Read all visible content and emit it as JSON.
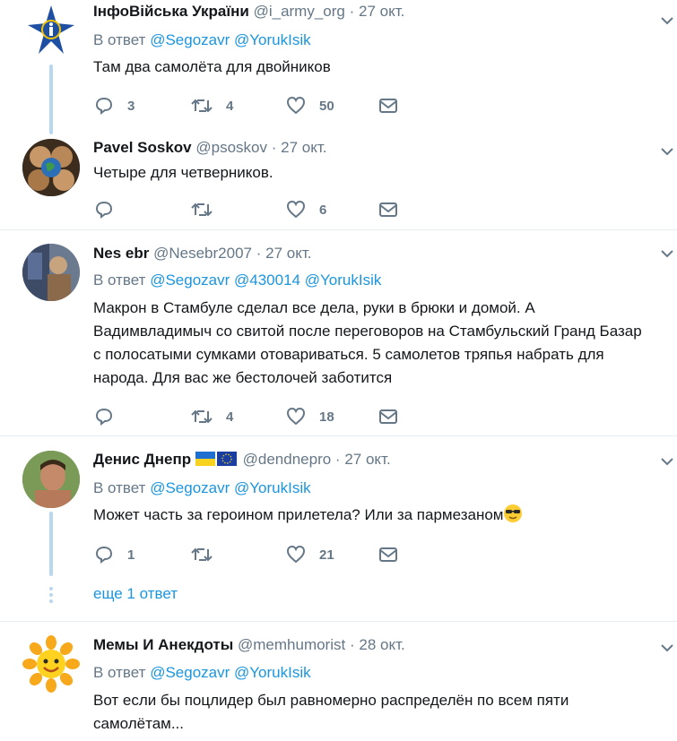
{
  "tweets": [
    {
      "name": "ІнфоВійська України",
      "handle": "@i_army_org",
      "sep": "·",
      "time": "27 окт.",
      "reply_prefix": "В ответ",
      "mentions": [
        "@Segozavr",
        "@YorukIsik"
      ],
      "text_lines": [
        "Там два самолёта для двойников"
      ],
      "reply_count": "3",
      "retweet_count": "4",
      "like_count": "50"
    },
    {
      "name": "Pavel Soskov",
      "handle": "@psoskov",
      "sep": "·",
      "time": "27 окт.",
      "text_lines": [
        "Четыре для четверников."
      ],
      "reply_count": "",
      "retweet_count": "",
      "like_count": "6"
    },
    {
      "name": "Nes ebr",
      "handle": "@Nesebr2007",
      "sep": "·",
      "time": "27 окт.",
      "reply_prefix": "В ответ",
      "mentions": [
        "@Segozavr",
        "@430014",
        "@YorukIsik"
      ],
      "text_lines": [
        "Макрон в Стамбуле сделал все дела, руки в брюки и домой. А",
        "Вадимвладимыч со свитой после переговоров на Стамбульский Гранд Базар",
        "с полосатыми сумками отовариваться. 5 самолетов тряпья набрать для",
        "народа. Для вас же бестолочей заботится"
      ],
      "reply_count": "",
      "retweet_count": "4",
      "like_count": "18"
    },
    {
      "name": "Денис Днепр",
      "handle": "@dendnepro",
      "sep": "·",
      "time": "27 окт.",
      "reply_prefix": "В ответ",
      "mentions": [
        "@Segozavr",
        "@YorukIsik"
      ],
      "text_lines": [
        "Может часть за героином прилетела? Или за пармезаном"
      ],
      "reply_count": "1",
      "retweet_count": "",
      "like_count": "21",
      "more_replies": "еще 1 ответ"
    },
    {
      "name": "Мемы И Анекдоты",
      "handle": "@memhumorist",
      "sep": "·",
      "time": "28 окт.",
      "reply_prefix": "В ответ",
      "mentions": [
        "@Segozavr",
        "@YorukIsik"
      ],
      "text_lines": [
        "Вот если бы поцлидер был равномерно распределён по всем пяти",
        "самолётам..."
      ]
    }
  ],
  "icons": {
    "reply": "reply-icon",
    "retweet": "retweet-icon",
    "like": "heart-icon",
    "dm": "envelope-icon",
    "menu": "chevron-down-icon"
  },
  "colors": {
    "link": "#1b95e0",
    "muted": "#657786",
    "thread": "#b8d7f0",
    "divider": "#e6ecf0"
  }
}
